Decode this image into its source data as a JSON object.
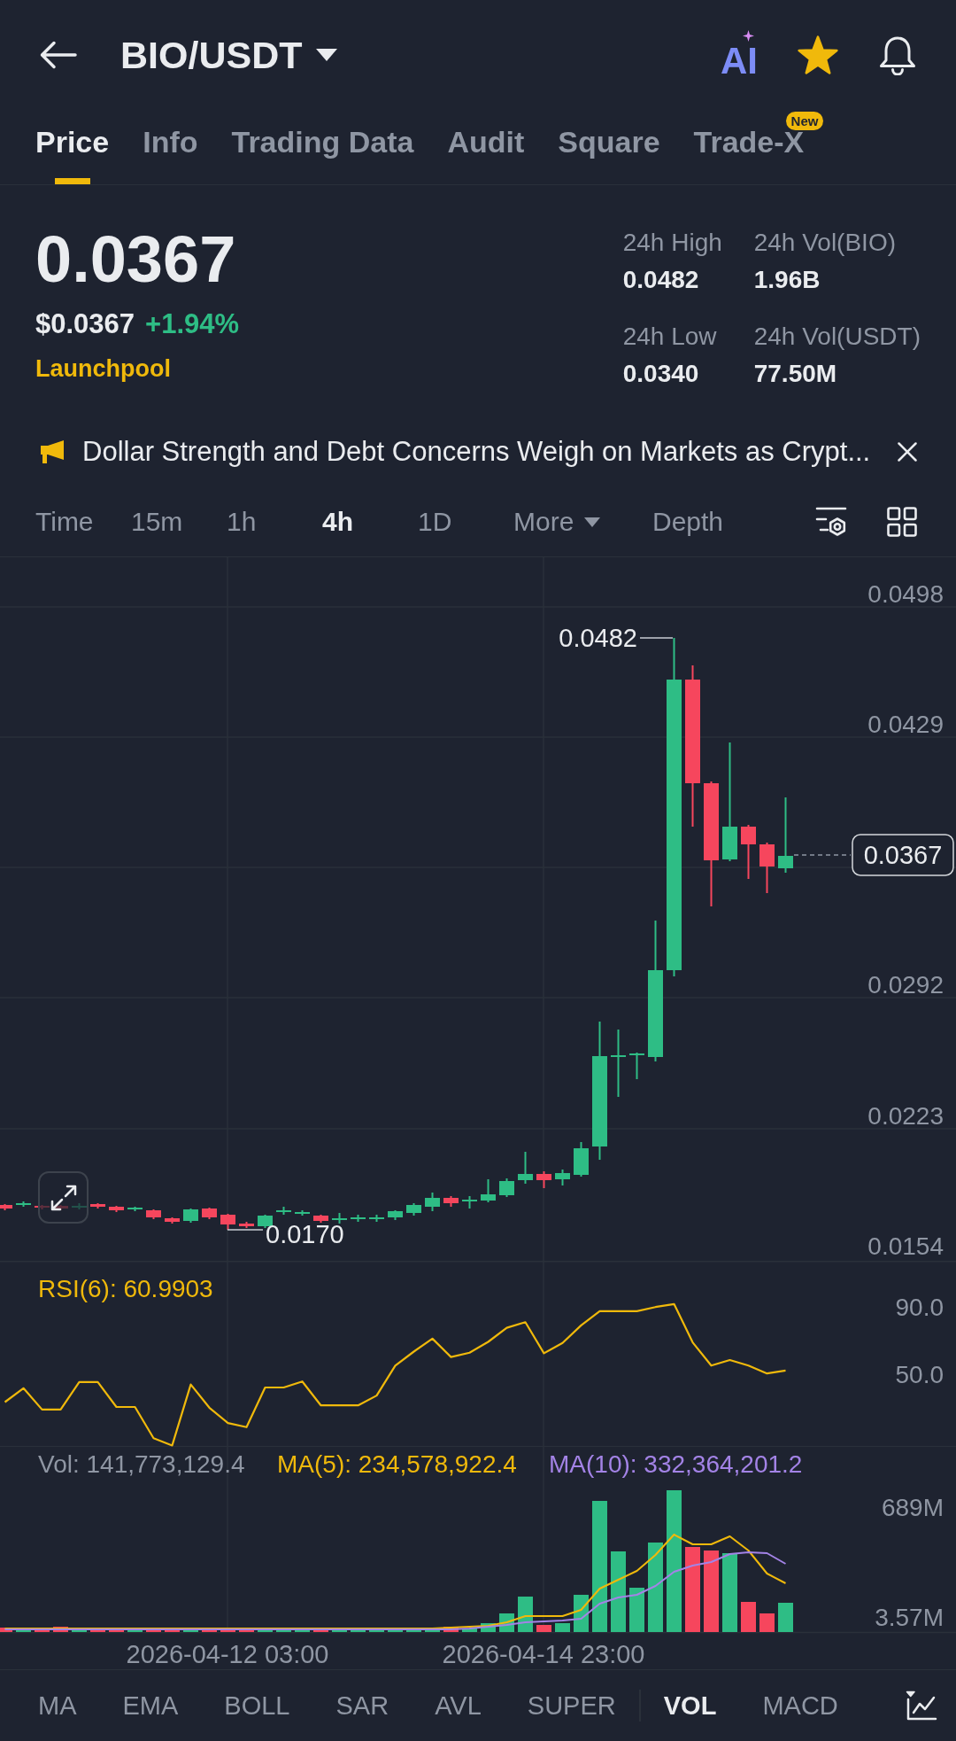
{
  "header": {
    "pair": "BIO/USDT",
    "ai_label": "AI",
    "favorite": true
  },
  "tabs": [
    {
      "label": "Price",
      "selected": true
    },
    {
      "label": "Info",
      "selected": false
    },
    {
      "label": "Trading Data",
      "selected": false
    },
    {
      "label": "Audit",
      "selected": false
    },
    {
      "label": "Square",
      "selected": false
    },
    {
      "label": "Trade-X",
      "selected": false,
      "badge": "New"
    }
  ],
  "ticker": {
    "last_price": "0.0367",
    "usd_price": "$0.0367",
    "change": "+1.94%",
    "tag": "Launchpool",
    "stats": [
      {
        "label": "24h High",
        "value": "0.0482"
      },
      {
        "label": "24h Vol(BIO)",
        "value": "1.96B"
      },
      {
        "label": "24h Low",
        "value": "0.0340"
      },
      {
        "label": "24h Vol(USDT)",
        "value": "77.50M"
      }
    ]
  },
  "news": {
    "headline": "Dollar Strength and Debt Concerns Weigh on Markets as Crypt..."
  },
  "intervals": [
    {
      "label": "Time",
      "kind": "option",
      "selected": false
    },
    {
      "label": "15m",
      "kind": "option",
      "selected": false
    },
    {
      "label": "1h",
      "kind": "option",
      "selected": false
    },
    {
      "label": "4h",
      "kind": "option",
      "selected": true
    },
    {
      "label": "1D",
      "kind": "option",
      "selected": false
    },
    {
      "label": "More",
      "kind": "menu",
      "selected": false
    },
    {
      "label": "Depth",
      "kind": "option",
      "selected": false
    }
  ],
  "price_chart": {
    "y_labels": [
      "0.0498",
      "0.0429",
      "0.0292",
      "0.0223",
      "0.0154"
    ],
    "high_label": "0.0482",
    "low_label": "0.0170",
    "current_price": "0.0367"
  },
  "rsi": {
    "label": "RSI(6): 60.9903",
    "chart_data": {
      "type": "line",
      "categories": [
        null,
        null,
        null,
        null,
        null,
        null,
        null,
        null,
        null,
        null,
        null,
        null,
        null,
        null,
        null,
        null,
        null,
        null,
        null,
        null,
        null,
        null,
        null,
        null,
        null,
        null,
        null,
        null,
        null,
        null,
        null,
        null,
        null,
        null,
        null,
        null,
        null,
        null,
        null,
        null,
        null,
        null,
        null
      ],
      "series": [
        {
          "color": "#f0b90b",
          "values": [
            33.4,
            41.7,
            29.0,
            29.0,
            45.3,
            45.3,
            30.5,
            30.5,
            12.0,
            7.7,
            43.9,
            30.1,
            21.0,
            18.5,
            42.1,
            42.1,
            45.7,
            31.5,
            31.5,
            31.5,
            37.3,
            55.1,
            63.4,
            71.1,
            60.2,
            62.8,
            69.2,
            77.6,
            80.9,
            62.4,
            68.5,
            79.0,
            87.4,
            87.4,
            87.4,
            89.9,
            91.7,
            68.9,
            55.1,
            58.4,
            55.1,
            50.4,
            52.2
          ]
        }
      ],
      "ylim": [
        7,
        117
      ],
      "yticks": [
        {
          "value": 90,
          "label": "90.0"
        },
        {
          "value": 50,
          "label": "50.0"
        }
      ]
    }
  },
  "volume": {
    "readings": [
      {
        "text": "Vol: 141,773,129.4",
        "color": "#8f96a3"
      },
      {
        "text": "MA(5): 234,578,922.4",
        "color": "#f0b90b"
      },
      {
        "text": "MA(10): 332,364,201.2",
        "color": "#a383e6"
      }
    ],
    "y_labels": [
      "689M",
      "3.57M"
    ]
  },
  "time_axis": [
    "2026-04-12 03:00",
    "2026-04-14 23:00"
  ],
  "indicators": {
    "main": [
      {
        "label": "MA",
        "selected": false
      },
      {
        "label": "EMA",
        "selected": false
      },
      {
        "label": "BOLL",
        "selected": false
      },
      {
        "label": "SAR",
        "selected": false
      },
      {
        "label": "AVL",
        "selected": false
      },
      {
        "label": "SUPER",
        "selected": false
      }
    ],
    "sub": [
      {
        "label": "VOL",
        "selected": true
      },
      {
        "label": "MACD",
        "selected": false
      }
    ]
  }
}
